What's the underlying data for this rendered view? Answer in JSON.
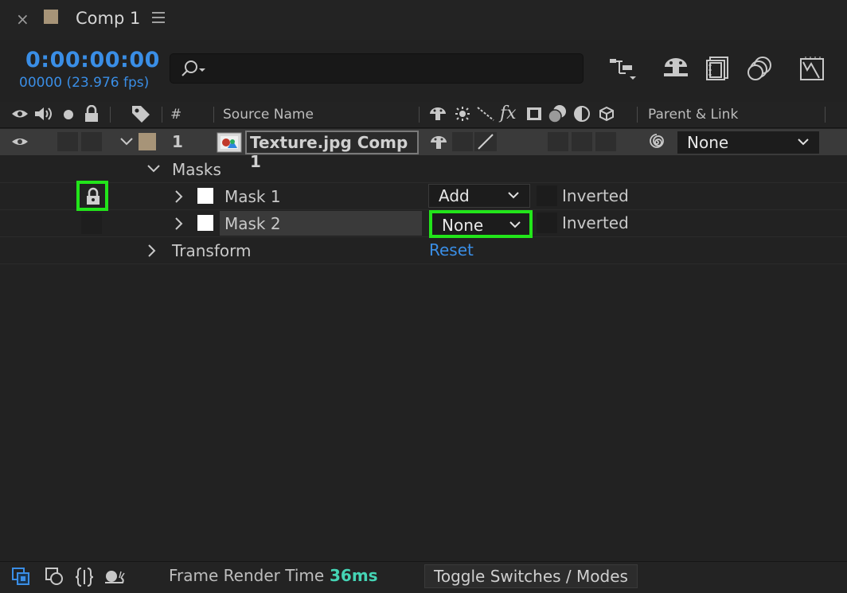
{
  "tab": {
    "title": "Comp 1",
    "close": "×",
    "swatch_color": "#a79478"
  },
  "time": {
    "timecode": "0:00:00:00",
    "frame_fps": "00000 (23.976 fps)"
  },
  "search": {
    "placeholder": ""
  },
  "toolbar": {
    "icons": [
      "composition-flowchart-icon",
      "draft-3d-icon",
      "frame-blending-icon",
      "motion-blur-icon",
      "graph-editor-icon"
    ]
  },
  "columns": {
    "hash": "#",
    "source_name": "Source Name",
    "parent_link": "Parent & Link"
  },
  "layer": {
    "number": "1",
    "name": "Texture.jpg Comp 1",
    "parent": "None",
    "swatch_color": "#a79478"
  },
  "masks": {
    "label": "Masks",
    "items": [
      {
        "name": "Mask 1",
        "mode": "Add",
        "inverted": "Inverted"
      },
      {
        "name": "Mask 2",
        "mode": "None",
        "inverted": "Inverted"
      }
    ]
  },
  "transform": {
    "label": "Transform",
    "reset": "Reset"
  },
  "bottom": {
    "frame_render_label": "Frame Render Time",
    "frame_render_value": "36ms",
    "toggle": "Toggle Switches / Modes"
  },
  "colors": {
    "accent": "#3a8ee6",
    "highlight": "#22e51a",
    "render_time": "#45d4b5"
  }
}
